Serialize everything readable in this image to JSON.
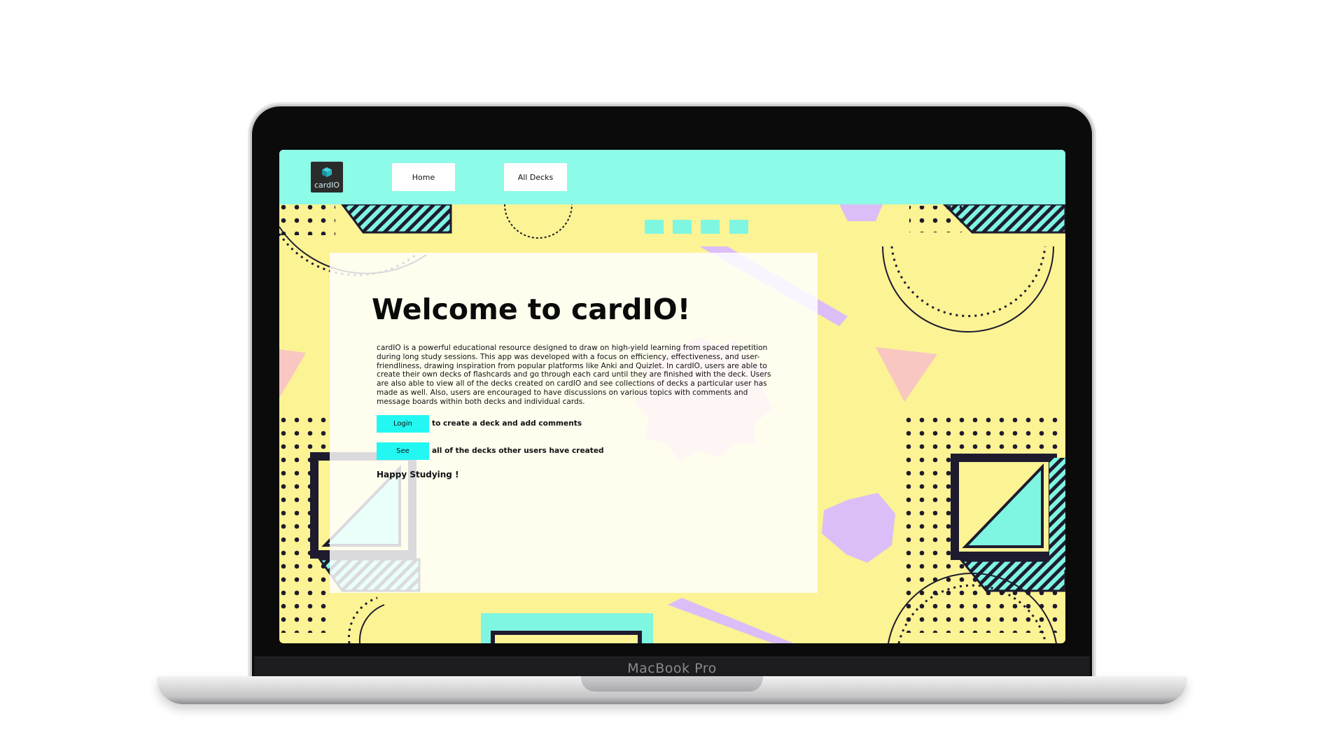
{
  "device": {
    "brand_label": "MacBook Pro"
  },
  "nav": {
    "logo_text": "cardIO",
    "home_label": "Home",
    "all_decks_label": "All Decks"
  },
  "main": {
    "title": "Welcome to cardIO!",
    "description": "cardIO is a powerful educational resource designed to draw on high-yield learning from spaced repetition during long study sessions. This app was developed with a focus on efficiency, effectiveness, and user-friendliness, drawing inspiration from popular platforms like Anki and Quizlet. In cardIO, users are able to create their own decks of flashcards and go through each card until they are finished with the deck. Users are also able to view all of the decks created on cardIO and see collections of decks a particular user has made as well. Also, users are encouraged to have discussions on various topics with comments and message boards within both decks and individual cards.",
    "login_label": "Login",
    "login_caption": "to create a deck and add comments",
    "see_label": "See",
    "see_caption": "all of the decks other users have created",
    "closing": "Happy Studying !"
  },
  "colors": {
    "navbar": "#8cfbe7",
    "background": "#fbf394",
    "button_accent": "#23f7f2",
    "pattern_cyan": "#7ff6e0",
    "pattern_lavender": "#dbbef7",
    "pattern_pink": "#f9c7c1",
    "pattern_dark": "#1e1b2e"
  },
  "icons": {
    "logo": "cube-icon"
  }
}
